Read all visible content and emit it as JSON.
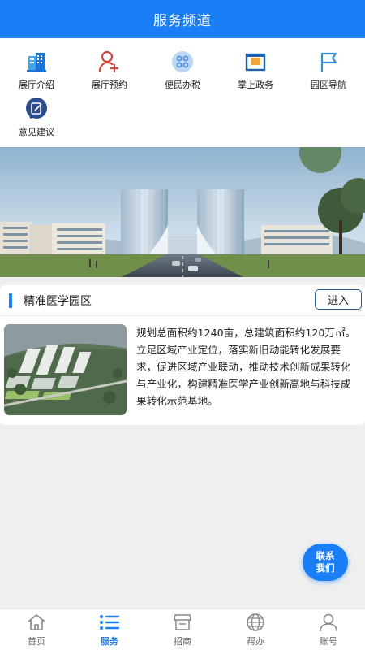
{
  "header": {
    "title": "服务频道"
  },
  "grid": {
    "items": [
      {
        "label": "展厅介绍",
        "icon": "building-icon"
      },
      {
        "label": "展厅预约",
        "icon": "user-add-icon"
      },
      {
        "label": "便民办税",
        "icon": "apps-icon"
      },
      {
        "label": "掌上政务",
        "icon": "id-card-icon"
      },
      {
        "label": "园区导航",
        "icon": "flag-icon"
      },
      {
        "label": "意见建议",
        "icon": "feedback-icon"
      }
    ]
  },
  "banner": {
    "image": "city-buildings-rendering"
  },
  "park": {
    "title": "精准医学园区",
    "enter_label": "进入",
    "description": "规划总面积约1240亩，总建筑面积约120万㎡。立足区域产业定位，落实新旧动能转化发展要求，促进区域产业联动，推动技术创新成果转化与产业化，构建精准医学产业创新高地与科技成果转化示范基地。",
    "thumbnail": "park-aerial-view"
  },
  "contact": {
    "line1": "联系",
    "line2": "我们"
  },
  "tabbar": {
    "active": "服务",
    "tabs": [
      {
        "label": "首页",
        "icon": "home-icon"
      },
      {
        "label": "服务",
        "icon": "list-icon"
      },
      {
        "label": "招商",
        "icon": "store-icon"
      },
      {
        "label": "帮办",
        "icon": "globe-icon"
      },
      {
        "label": "账号",
        "icon": "person-icon"
      }
    ]
  },
  "colors": {
    "primary": "#1a7ef6",
    "background": "#efefef",
    "accent_red": "#d0453c"
  }
}
